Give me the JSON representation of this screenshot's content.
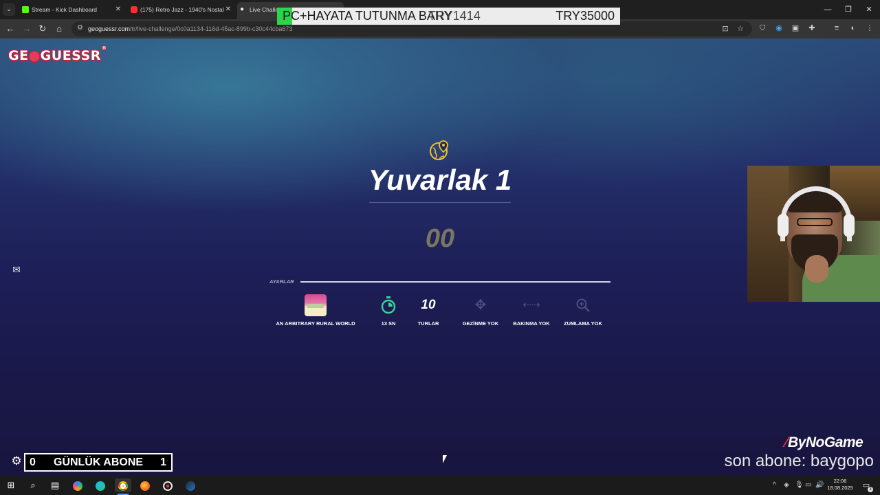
{
  "browser": {
    "tabs": [
      {
        "title": "Stream - Kick Dashboard",
        "favicon_color": "#53fc18"
      },
      {
        "title": "(175) Retro Jazz - 1940's Nostal",
        "favicon_color": "#ff2d2d"
      },
      {
        "title": "Live Challe",
        "favicon_color": "#e8e8e8"
      }
    ],
    "url_domain": "geoguessr.com",
    "url_path": "/tr/live-challenge/0c0a1134-116d-45ac-899b-c30c44cba673"
  },
  "donation_overlay": {
    "message": "PC+HAYATA TUTUNMA BARY",
    "current": "TRY1414",
    "goal": "TRY35000",
    "accent": "#2fd24a"
  },
  "geoguessr": {
    "logo": "GEOGUESSR",
    "round_title": "Yuvarlak 1",
    "countdown": "00",
    "settings_label": "AYARLAR",
    "settings": [
      {
        "label": "AN ARBITRARY RURAL WORLD",
        "icon": "map-thumbnail"
      },
      {
        "label": "13 SN",
        "icon": "stopwatch-icon",
        "icon_color": "#3ad39a"
      },
      {
        "value": "10",
        "label": "TURLAR"
      },
      {
        "label": "GEZİNME YOK",
        "icon": "move-arrows-icon"
      },
      {
        "label": "BAKINMA YOK",
        "icon": "pan-arrows-icon"
      },
      {
        "label": "ZUMLAMA YOK",
        "icon": "zoom-icon"
      }
    ],
    "accent_colors": {
      "logo_red": "#c4213a",
      "round_icon": "#f2c22b",
      "countdown": "#7a7660"
    }
  },
  "stream_overlay": {
    "brand": "ByNoGame",
    "last_sub_text": "son abone: baygopo",
    "sub_counter": {
      "left": "0",
      "label": "GÜNLÜK ABONE",
      "right": "1"
    }
  },
  "taskbar": {
    "time": "22:06",
    "date": "18.08.2025",
    "notification_count": "3"
  }
}
